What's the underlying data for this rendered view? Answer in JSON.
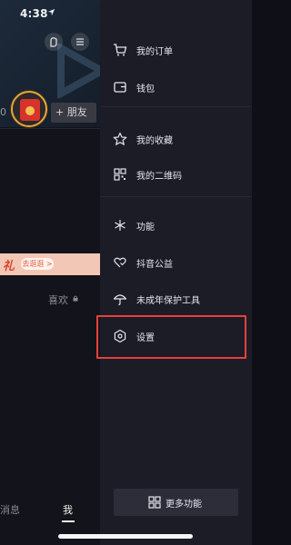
{
  "status_bar": {
    "time": "4:38"
  },
  "background_profile": {
    "count_partial": "0",
    "add_friend_label": "+ 朋友",
    "promo_text": "礼",
    "promo_button": "去逛逛 >",
    "likes_tab": "喜欢",
    "nav": {
      "messages_partial": "消息",
      "me": "我"
    }
  },
  "drawer": {
    "items": [
      {
        "label": "我的订单",
        "icon": "cart-icon"
      },
      {
        "label": "钱包",
        "icon": "wallet-icon"
      },
      {
        "label": "我的收藏",
        "icon": "star-icon"
      },
      {
        "label": "我的二维码",
        "icon": "qrcode-icon"
      },
      {
        "label": "功能",
        "icon": "sparkle-icon"
      },
      {
        "label": "抖音公益",
        "icon": "heart-hands-icon"
      },
      {
        "label": "未成年保护工具",
        "icon": "umbrella-icon"
      },
      {
        "label": "设置",
        "icon": "settings-icon"
      }
    ],
    "more_label": "更多功能"
  },
  "colors": {
    "drawer_bg": "#1b1c26",
    "highlight_border": "#e6403a",
    "text": "#e6e6ec"
  }
}
